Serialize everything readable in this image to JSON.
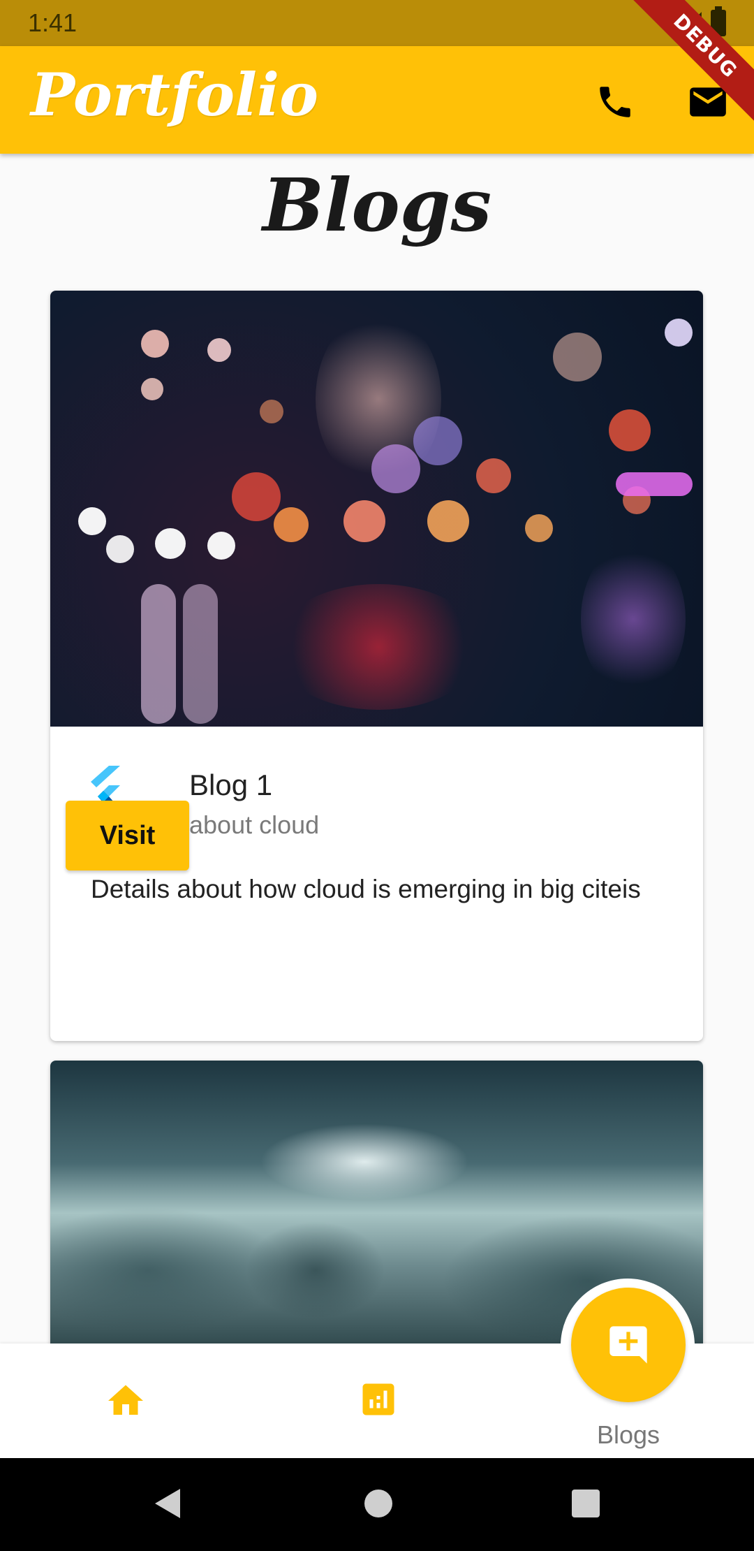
{
  "status_bar": {
    "time": "1:41"
  },
  "debug_banner": {
    "label": "DEBUG"
  },
  "app_bar": {
    "title": "Portfolio",
    "actions": [
      {
        "icon": "phone-icon"
      },
      {
        "icon": "mail-icon"
      }
    ]
  },
  "page": {
    "title": "Blogs"
  },
  "blogs": [
    {
      "image": "city-bokeh-night-lights",
      "icon": "flutter-logo-icon",
      "title": "Blog 1",
      "subtitle": "about cloud",
      "description": "Details about how cloud is emerging in big citeis",
      "button_label": "Visit"
    },
    {
      "image": "clouds-sky"
    }
  ],
  "bottom_nav": {
    "items": [
      {
        "icon": "home-icon"
      },
      {
        "icon": "stats-icon"
      },
      {
        "icon": "add-comment-icon",
        "label": "Blogs",
        "selected": true
      }
    ]
  },
  "colors": {
    "primary": "#ffc107",
    "status_bar": "#ba8d08",
    "debug": "#b21d15"
  },
  "system_nav": {
    "items": [
      "back-icon",
      "home-circle-icon",
      "recents-icon"
    ]
  }
}
